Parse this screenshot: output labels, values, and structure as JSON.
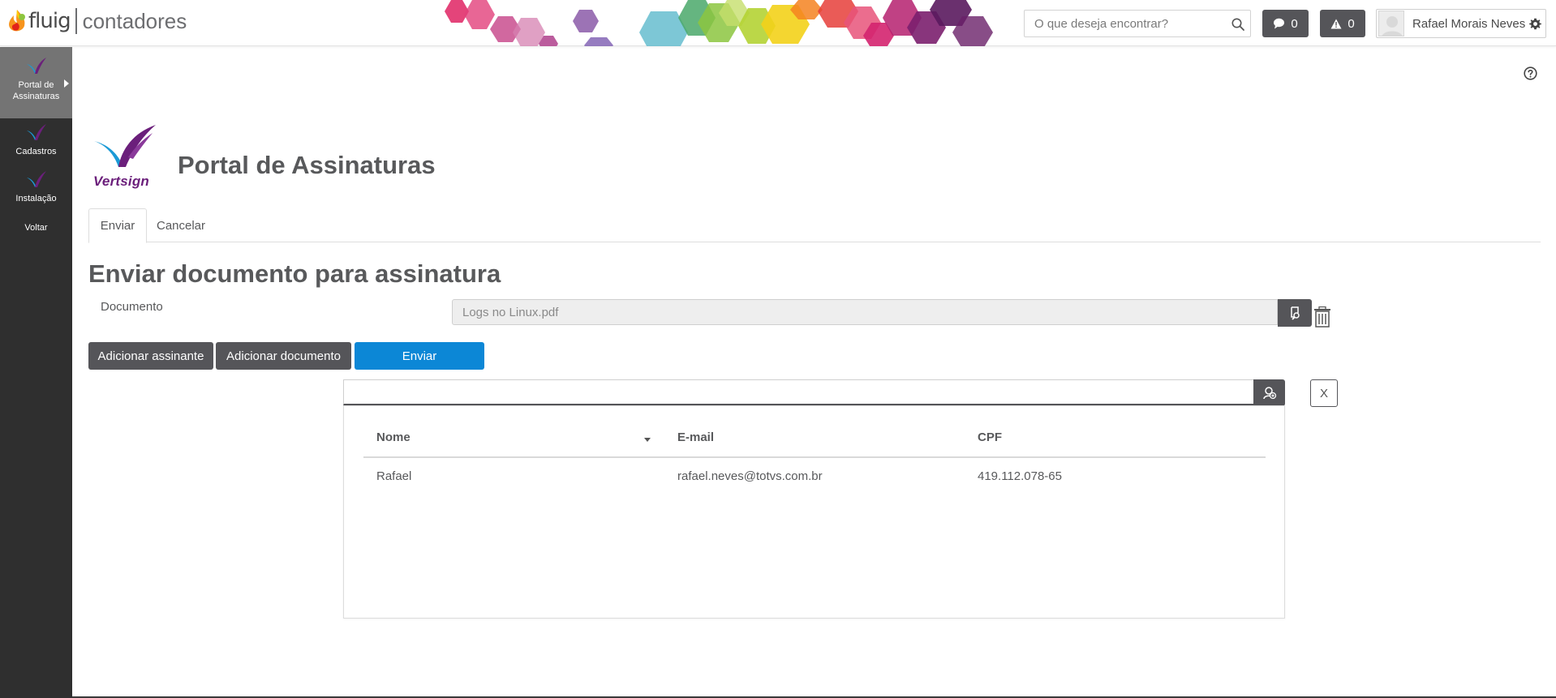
{
  "header": {
    "logo_text": "fluig",
    "company_name": "contadores",
    "search_placeholder": "O que deseja encontrar?",
    "messages_count": "0",
    "alerts_count": "0",
    "user_name": "Rafael Morais Neves"
  },
  "sidebar": {
    "items": [
      {
        "label_line1": "Portal de",
        "label_line2": "Assinaturas",
        "icon": "vertsign-icon",
        "active": true
      },
      {
        "label": "Cadastros",
        "icon": "vertsign-icon"
      },
      {
        "label": "Instalação",
        "icon": "vertsign-icon"
      },
      {
        "label": "Voltar"
      }
    ]
  },
  "page": {
    "logo_text": "Vertsign",
    "title": "Portal de Assinaturas",
    "tabs": [
      {
        "label": "Enviar",
        "active": true
      },
      {
        "label": "Cancelar"
      }
    ],
    "section_title": "Enviar documento para assinatura",
    "document_label": "Documento",
    "document_value": "Logs no Linux.pdf",
    "buttons": {
      "add_signer": "Adicionar assinante",
      "add_document": "Adicionar documento",
      "send": "Enviar"
    },
    "signer_search_value": "",
    "close_label": "X"
  },
  "signers_table": {
    "columns": [
      "Nome",
      "E-mail",
      "CPF"
    ],
    "rows": [
      {
        "name": "Rafael",
        "email": "rafael.neves@totvs.com.br",
        "cpf": "419.112.078-65"
      }
    ]
  },
  "colors": {
    "sidebar_bg": "#2f2f2f",
    "sidebar_active": "#747474",
    "dark_button": "#555559",
    "primary_button": "#0c87d6",
    "vertsign_purple": "#6b1f7b",
    "vertsign_blue": "#1b9ad6"
  }
}
